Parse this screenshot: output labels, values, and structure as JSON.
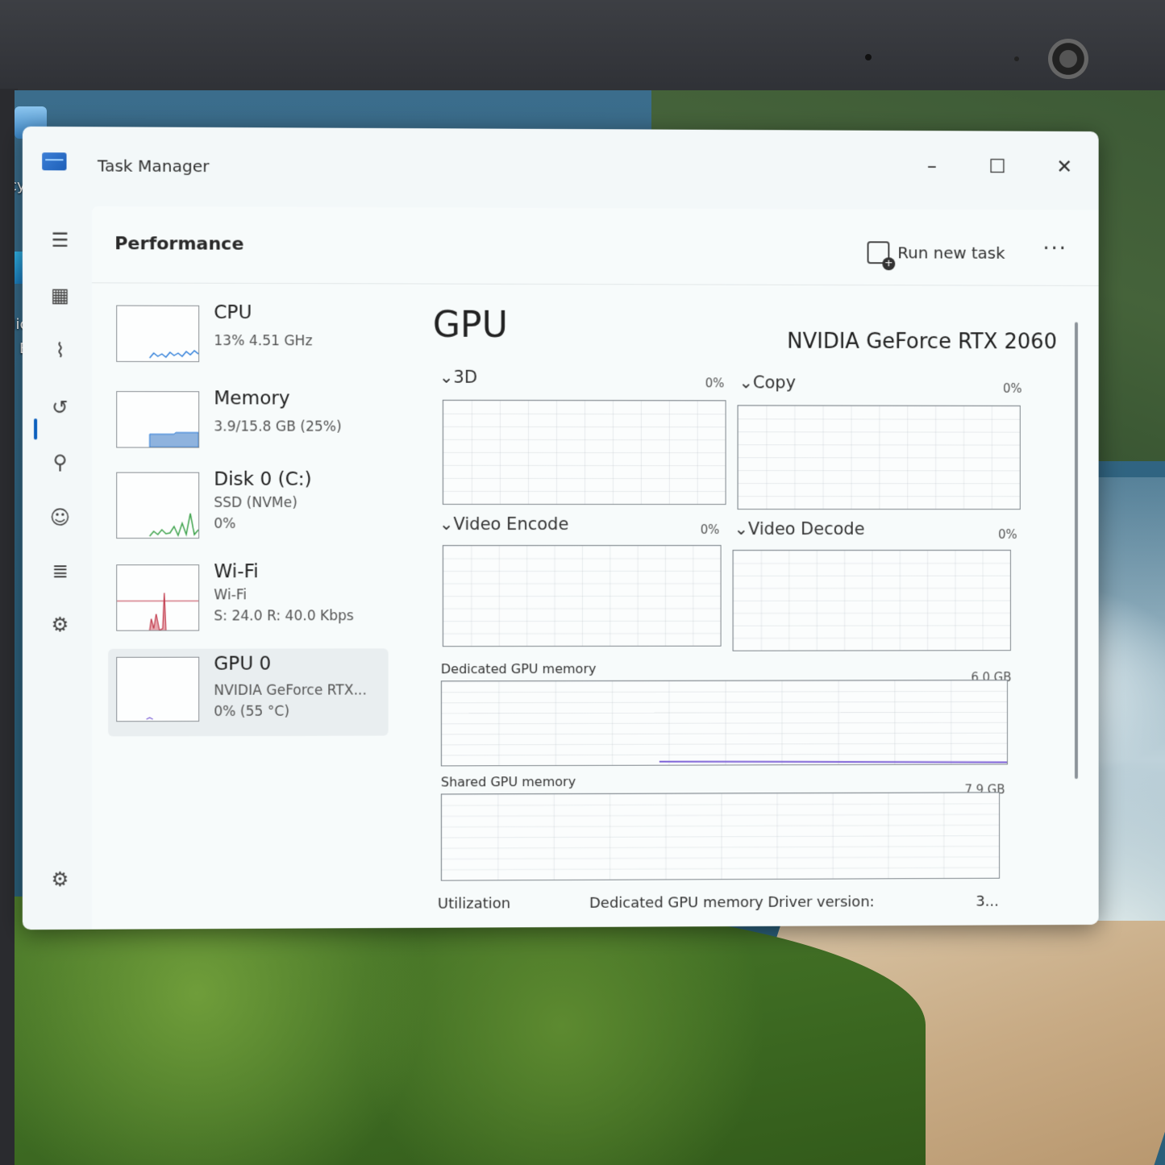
{
  "window": {
    "title": "Task Manager",
    "minimize_glyph": "–",
    "maximize_glyph": "☐",
    "close_glyph": "✕"
  },
  "desktop": {
    "icon_label_1": "ecy",
    "icon_label_2": "Mic",
    "icon_label_3": "Ed"
  },
  "nav": {
    "items": [
      {
        "icon": "hamburger-menu-icon",
        "glyph": "☰"
      },
      {
        "icon": "processes-icon",
        "glyph": "▦"
      },
      {
        "icon": "performance-icon",
        "glyph": "⌇"
      },
      {
        "icon": "app-history-icon",
        "glyph": "↺"
      },
      {
        "icon": "startup-apps-icon",
        "glyph": "⚲"
      },
      {
        "icon": "users-icon",
        "glyph": "☺"
      },
      {
        "icon": "details-icon",
        "glyph": "≣"
      },
      {
        "icon": "services-icon",
        "glyph": "⚙"
      }
    ],
    "settings_glyph": "⚙"
  },
  "header": {
    "page_title": "Performance",
    "run_new_task": "Run new task",
    "more_glyph": "···"
  },
  "perf_list": [
    {
      "name": "CPU",
      "sub1": "13%  4.51 GHz",
      "sub2": "",
      "sub3": ""
    },
    {
      "name": "Memory",
      "sub1": "3.9/15.8 GB (25%)",
      "sub2": "",
      "sub3": ""
    },
    {
      "name": "Disk 0 (C:)",
      "sub1": "SSD (NVMe)",
      "sub2": "0%",
      "sub3": ""
    },
    {
      "name": "Wi-Fi",
      "sub1": "Wi-Fi",
      "sub2": "S: 24.0  R: 40.0 Kbps",
      "sub3": ""
    },
    {
      "name": "GPU 0",
      "sub1": "NVIDIA GeForce RTX...",
      "sub2": "0%  (55 °C)",
      "sub3": ""
    }
  ],
  "gpu": {
    "title": "GPU",
    "model": "NVIDIA GeForce RTX 2060",
    "engines": [
      {
        "label": "3D",
        "pct": "0%"
      },
      {
        "label": "Copy",
        "pct": "0%"
      },
      {
        "label": "Video Encode",
        "pct": "0%"
      },
      {
        "label": "Video Decode",
        "pct": "0%"
      }
    ],
    "dedicated_label": "Dedicated GPU memory",
    "dedicated_max": "6.0 GB",
    "shared_label": "Shared GPU memory",
    "shared_max": "7.9 GB",
    "footer": {
      "utilization": "Utilization",
      "dedicated": "Dedicated GPU memory",
      "driver": "Driver version:",
      "driver_value": "3..."
    }
  },
  "colors": {
    "accent": "#0a5fbd",
    "cpu_line": "#2a7bd8",
    "mem_fill": "#8fb3de",
    "disk_line": "#3fa34d",
    "wifi_line": "#c0394b",
    "gpu_line": "#7b5fd6"
  }
}
